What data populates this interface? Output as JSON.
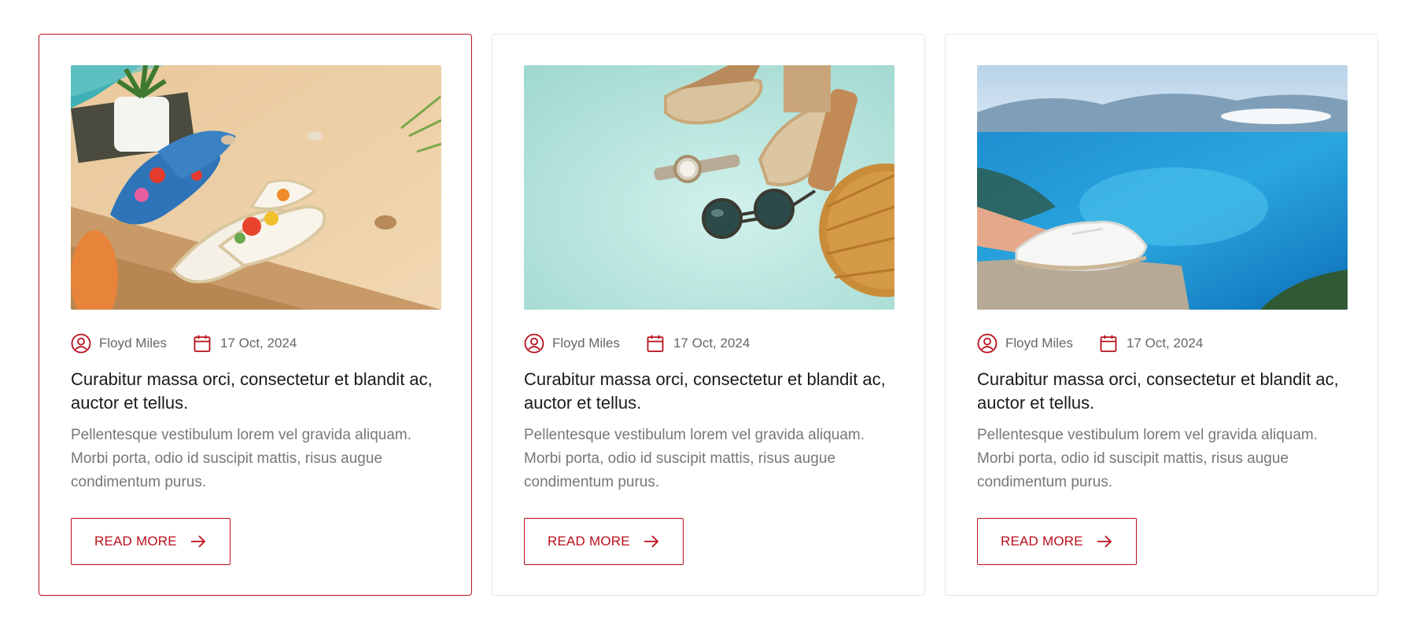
{
  "theme": {
    "accent": "#b80f1a",
    "text": "#1a1a1a",
    "muted": "#777777",
    "border": "#e6e6e6"
  },
  "icons": {
    "author": "user-circle-icon",
    "date": "calendar-icon",
    "button": "arrow-right-icon"
  },
  "posts": [
    {
      "image": "beach-espadrilles-photo",
      "author": "Floyd Miles",
      "date": "17 Oct, 2024",
      "title": "Curabitur massa orci, consectetur et blandit ac, auctor et tellus.",
      "excerpt": "Pellentesque vestibulum lorem vel gravida aliquam. Morbi porta, odio id suscipit mattis, risus augue condimentum purus.",
      "button_label": "READ MORE",
      "highlighted": true
    },
    {
      "image": "summer-accessories-flatlay-photo",
      "author": "Floyd Miles",
      "date": "17 Oct, 2024",
      "title": "Curabitur massa orci, consectetur et blandit ac, auctor et tellus.",
      "excerpt": "Pellentesque vestibulum lorem vel gravida aliquam. Morbi porta, odio id suscipit mattis, risus augue condimentum purus.",
      "button_label": "READ MORE",
      "highlighted": false
    },
    {
      "image": "sneakers-sea-view-photo",
      "author": "Floyd Miles",
      "date": "17 Oct, 2024",
      "title": "Curabitur massa orci, consectetur et blandit ac, auctor et tellus.",
      "excerpt": "Pellentesque vestibulum lorem vel gravida aliquam. Morbi porta, odio id suscipit mattis, risus augue condimentum purus.",
      "button_label": "READ MORE",
      "highlighted": false
    }
  ]
}
